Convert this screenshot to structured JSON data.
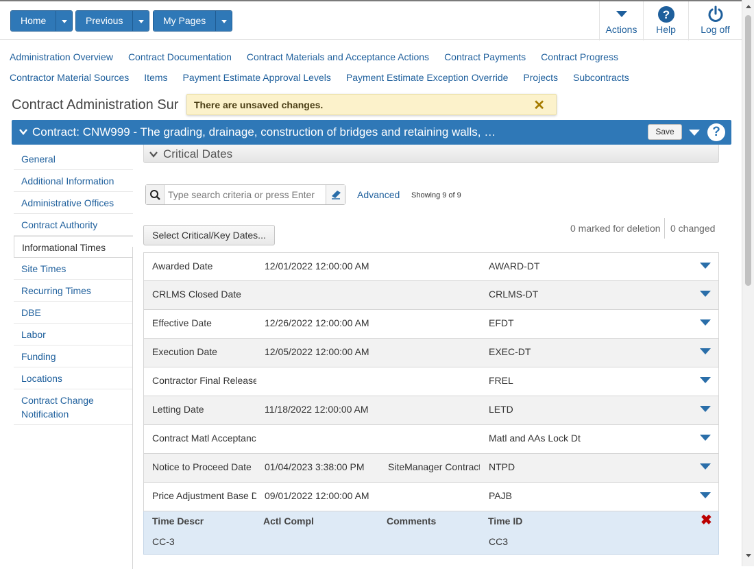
{
  "topbar": {
    "home": "Home",
    "previous": "Previous",
    "my_pages": "My Pages",
    "actions": "Actions",
    "help": "Help",
    "logoff": "Log off"
  },
  "links": {
    "row1": [
      "Administration Overview",
      "Contract Documentation",
      "Contract Materials and Acceptance Actions",
      "Contract Payments",
      "Contract Progress"
    ],
    "row2": [
      "Contractor Material Sources",
      "Items",
      "Payment Estimate Approval Levels",
      "Payment Estimate Exception Override",
      "Projects",
      "Subcontracts"
    ]
  },
  "page_title": "Contract Administration Sur",
  "toast": {
    "message": "There are unsaved changes."
  },
  "contract_bar": {
    "title": "Contract: CNW999 - The grading, drainage, construction of bridges and retaining walls, …",
    "save": "Save"
  },
  "leftnav": {
    "items": [
      "General",
      "Additional Information",
      "Administrative Offices",
      "Contract Authority",
      "Informational Times",
      "Site Times",
      "Recurring Times",
      "DBE",
      "Labor",
      "Funding",
      "Locations",
      "Contract Change Notification"
    ]
  },
  "section": {
    "title": "Critical Dates"
  },
  "search": {
    "placeholder": "Type search criteria or press Enter",
    "advanced": "Advanced",
    "showing": "Showing 9 of 9"
  },
  "select_button": "Select Critical/Key Dates...",
  "status": {
    "marked": "0 marked for deletion",
    "changed": "0 changed"
  },
  "rows": [
    {
      "descr": "Awarded Date",
      "date": "12/01/2022 12:00:00 AM",
      "comment": "",
      "id": "AWARD-DT"
    },
    {
      "descr": "CRLMS Closed Date",
      "date": "",
      "comment": "",
      "id": "CRLMS-DT"
    },
    {
      "descr": "Effective Date",
      "date": "12/26/2022 12:00:00 AM",
      "comment": "",
      "id": "EFDT"
    },
    {
      "descr": "Execution Date",
      "date": "12/05/2022 12:00:00 AM",
      "comment": "",
      "id": "EXEC-DT"
    },
    {
      "descr": "Contractor Final Release",
      "date": "",
      "comment": "",
      "id": "FREL"
    },
    {
      "descr": "Letting Date",
      "date": "11/18/2022 12:00:00 AM",
      "comment": "",
      "id": "LETD"
    },
    {
      "descr": "Contract Matl Acceptance",
      "date": "",
      "comment": "",
      "id": "Matl and AAs Lock Dt"
    },
    {
      "descr": "Notice to Proceed Date",
      "date": "01/04/2023 3:38:00 PM",
      "comment": "SiteManager Contract",
      "id": "NTPD"
    },
    {
      "descr": "Price Adjustment Base Date",
      "date": "09/01/2022 12:00:00 AM",
      "comment": "",
      "id": "PAJB"
    }
  ],
  "edit_row": {
    "headers": {
      "descr": "Time Descr",
      "actl": "Actl Compl",
      "comments": "Comments",
      "id": "Time ID"
    },
    "values": {
      "descr": "CC-3",
      "id": "CC3"
    }
  }
}
